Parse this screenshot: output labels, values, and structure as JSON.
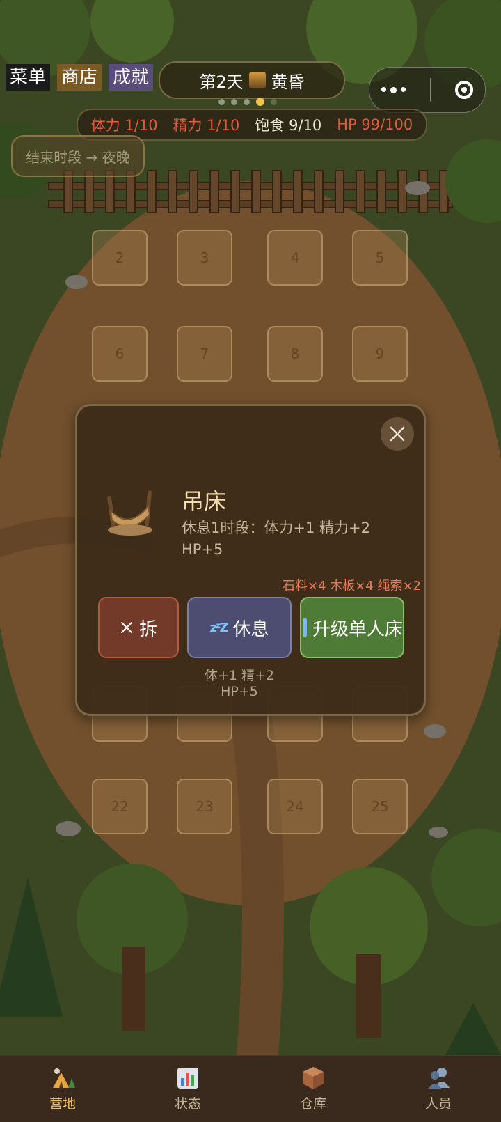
{
  "top_menu": {
    "menu": "菜单",
    "shop": "商店",
    "achievements": "成就"
  },
  "day": {
    "label": "第2天",
    "period_icon": "dusk-icon",
    "period": "黄昏"
  },
  "page_dots": {
    "count": 5,
    "active_index": 3
  },
  "capsule": {
    "more_icon": "more-icon",
    "close_icon": "target-icon"
  },
  "stats": {
    "stamina": "体力 1/10",
    "energy": "精力 1/10",
    "satiety": "饱食 9/10",
    "hp": "HP 99/100"
  },
  "end_period_button": "结束时段 → 夜晚",
  "slots": [
    "2",
    "3",
    "4",
    "5",
    "6",
    "7",
    "8",
    "9",
    "22",
    "23",
    "24",
    "25"
  ],
  "modal": {
    "title": "吊床",
    "icon": "hammock-icon",
    "description": "休息1时段：体力+1 精力+2 HP+5",
    "cost": "石料×4 木板×4 绳索×2",
    "demolish_label": "拆",
    "rest_label": "休息",
    "upgrade_label": "升级单人床",
    "rest_effect": "体+1 精+2 HP+5"
  },
  "bottom_nav": [
    {
      "label": "营地",
      "icon": "camp-icon",
      "active": true
    },
    {
      "label": "状态",
      "icon": "stats-chart-icon",
      "active": false
    },
    {
      "label": "仓库",
      "icon": "box-icon",
      "active": false
    },
    {
      "label": "人员",
      "icon": "people-icon",
      "active": false
    }
  ],
  "colors": {
    "accent": "#f6c24c",
    "stat_red": "#e15a3d",
    "rest_button": "#4c4d70",
    "upgrade_button": "#4e7b35",
    "demolish_button": "#733a2a"
  }
}
